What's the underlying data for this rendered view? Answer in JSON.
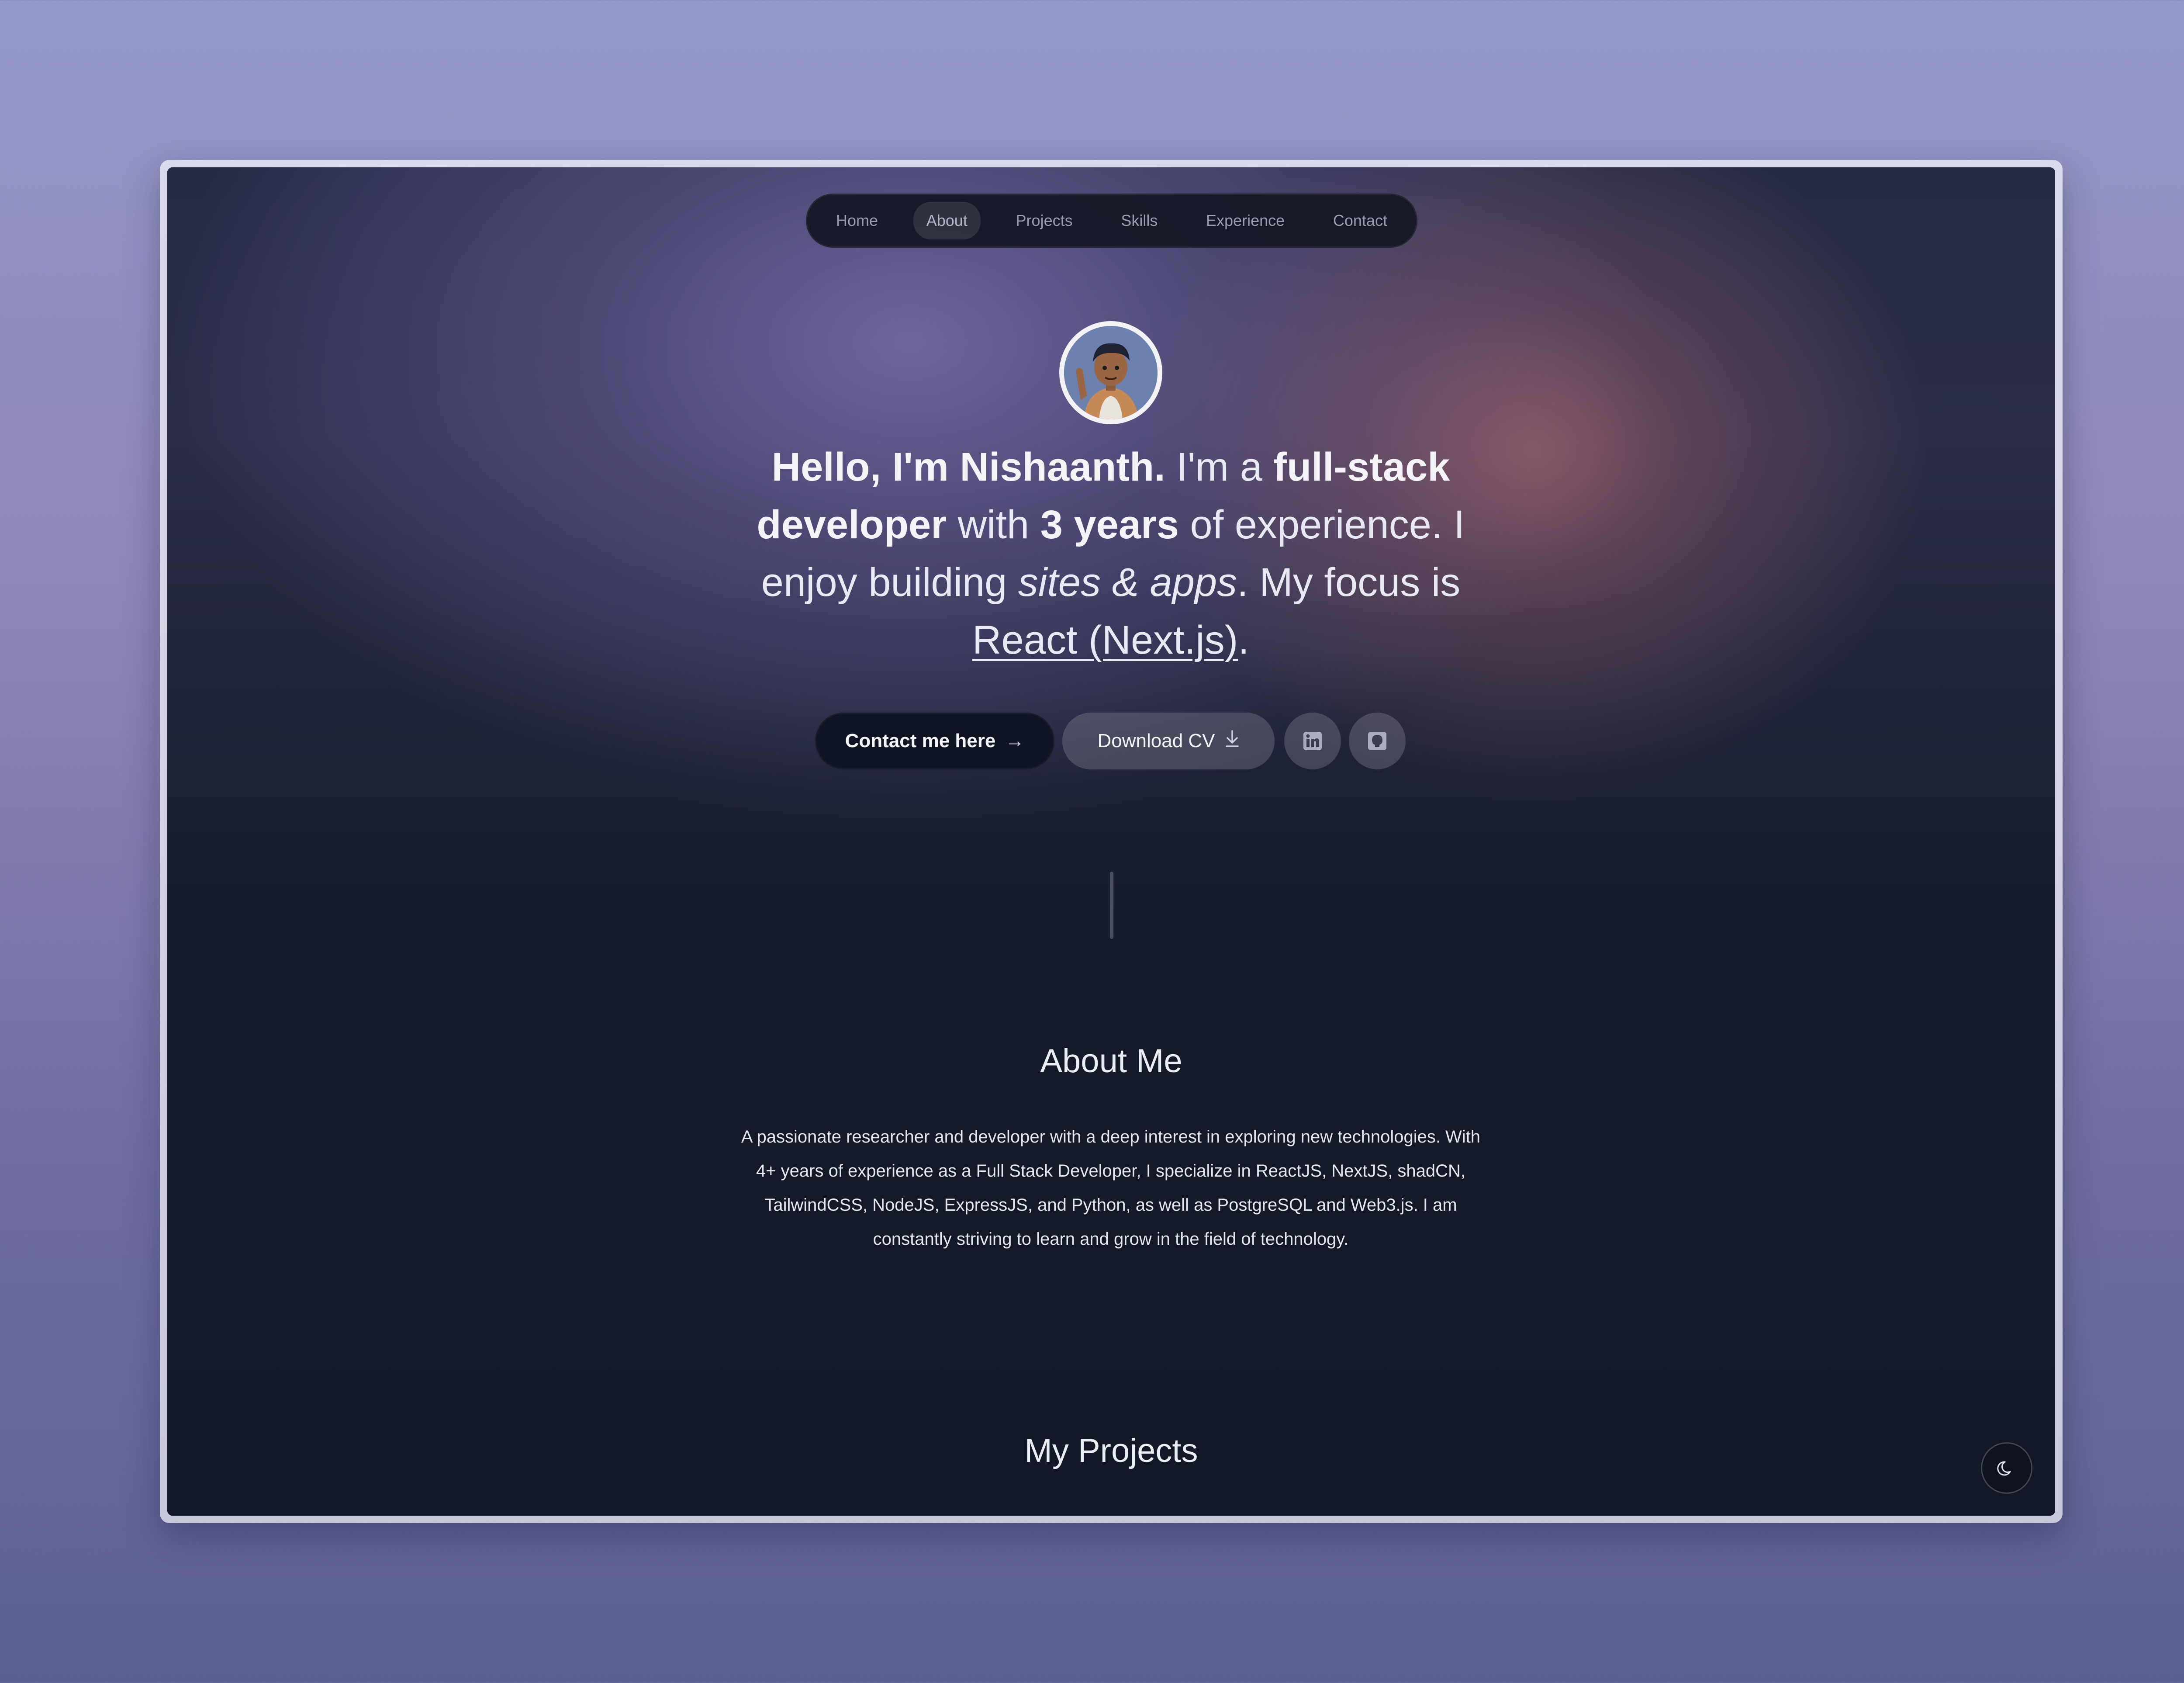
{
  "nav": {
    "items": [
      {
        "label": "Home",
        "active": false
      },
      {
        "label": "About",
        "active": true
      },
      {
        "label": "Projects",
        "active": false
      },
      {
        "label": "Skills",
        "active": false
      },
      {
        "label": "Experience",
        "active": false
      },
      {
        "label": "Contact",
        "active": false
      }
    ]
  },
  "hero": {
    "greeting": "Hello, I'm Nishaanth.",
    "im_a": " I'm a ",
    "role": "full-stack developer",
    "with": " with ",
    "years": "3 years",
    "of_experience": " of experience. I enjoy building ",
    "sites_apps": "sites & apps",
    "focus_text": ". My focus is ",
    "focus": "React (Next.js)",
    "end": "."
  },
  "buttons": {
    "contact_label": "Contact me here",
    "cv_label": "Download CV",
    "linkedin_icon": "linkedin-icon",
    "github_icon": "github-icon"
  },
  "about": {
    "title": "About Me",
    "text": "A passionate researcher and developer with a deep interest in exploring new technologies. With 4+ years of experience as a Full Stack Developer, I specialize in ReactJS, NextJS, shadCN, TailwindCSS, NodeJS, ExpressJS, and Python, as well as PostgreSQL and Web3.js. I am constantly striving to learn and grow in the field of technology."
  },
  "projects": {
    "title": "My Projects"
  },
  "theme_toggle": {
    "icon": "moon-icon"
  },
  "colors": {
    "page_bg_top": "#959ac8",
    "page_bg_bottom": "#5a5f8f",
    "screen_bg": "#131826",
    "primary_button": "#0f1422"
  }
}
